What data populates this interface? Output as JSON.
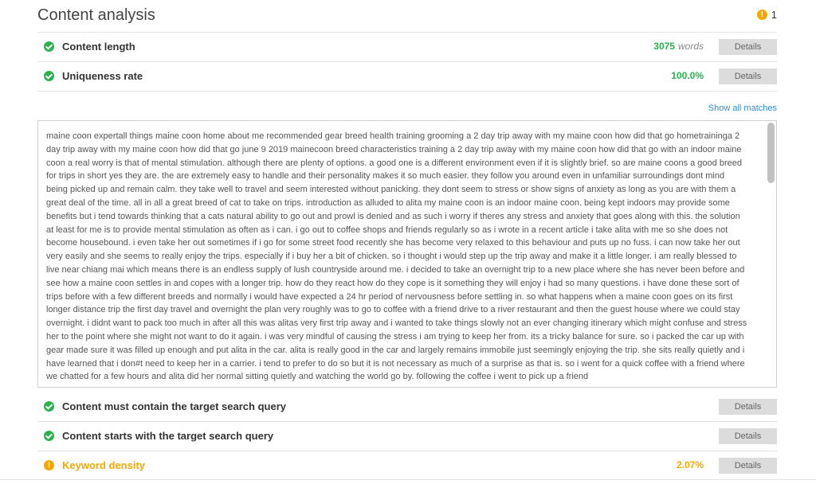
{
  "header": {
    "title": "Content analysis",
    "warning_count": "1"
  },
  "rows": {
    "content_length": {
      "label": "Content length",
      "value": "3075",
      "unit": "words",
      "button": "Details"
    },
    "uniqueness": {
      "label": "Uniqueness rate",
      "value": "100.0%",
      "button": "Details"
    },
    "target_query": {
      "label": "Content must contain the target search query",
      "button": "Details"
    },
    "starts_with": {
      "label": "Content starts with the target search query",
      "button": "Details"
    },
    "keyword_density": {
      "label": "Keyword density",
      "value": "2.07%",
      "button": "Details"
    }
  },
  "show_all_matches": "Show all matches",
  "text_content": "maine coon expertall things maine coon home about me recommended gear breed health training grooming a 2 day trip away with my maine coon how did that go hometraininga 2 day trip away with my maine coon how did that go june 9 2019 mainecoon breed characteristics training a 2 day trip away with my maine coon how did that go with an indoor maine coon a real worry is that of mental stimulation. although there are plenty of options. a good one is a different environment even if it is slightly brief. so are maine coons a good breed for trips in short yes they are. the are extremely easy to handle and their personality makes it so much easier. they follow you around even in unfamiliar surroundings dont mind being picked up and remain calm. they take well to travel and seem interested without panicking. they dont seem to stress or show signs of anxiety as long as you are with them a great deal of the time. all in all a great breed of cat to take on trips. introduction as alluded to alita my maine coon is an indoor maine coon. being kept indoors may provide some benefits but i tend towards thinking that a cats natural ability to go out and prowl is denied and as such i worry if theres any stress and anxiety that goes along with this. the solution at least for me is to provide mental stimulation as often as i can. i go out to coffee shops and friends regularly so as i wrote in a recent article i take alita with me so she does not become housebound. i even take her out sometimes if i go for some street food recently she has become very relaxed to this behaviour and puts up no fuss. i can now take her out very easily and she seems to really enjoy the trips. especially if i buy her a bit of chicken. so i thought i would step up the trip away and make it a little longer. i am really blessed to live near chiang mai which means there is an endless supply of lush countryside around me. i decided to take an overnight trip to a new place where she has never been before and see how a maine coon settles in and copes with a longer trip. how do they react how do they cope is it something they will enjoy i had so many questions. i have done these sort of trips before with a few different breeds and normally i would have expected a 24 hr period of nervousness before settling in. so what happens when a maine coon goes on its first longer distance trip the first day travel and overnight the plan very roughly was to go to coffee with a friend drive to a river restaurant and then the guest house where we could stay overnight. i didnt want to pack too much in after all this was alitas very first trip away and i wanted to take things slowly not an ever changing itinerary which might confuse and stress her to the point where she might not want to do it again. i was very mindful of causing the stress i am trying to keep her from. its a tricky balance for sure. so i packed the car up with gear made sure it was filled up enough and put alita in the car. alita is really good in the car and largely remains immobile just seemingly enjoying the trip. she sits really quietly and i have learned that i don#t need to keep her in a carrier. i tend to prefer to do so but it is not necessary as much of a surprise as that is. so i went for a quick coffee with a friend where we chatted for a few hours and alita did her normal sitting quietly and watching the world go by. following the coffee i went to pick up a friend",
  "colors": {
    "ok": "#27b34b",
    "warning": "#f5a700",
    "link": "#2b8fd6"
  }
}
